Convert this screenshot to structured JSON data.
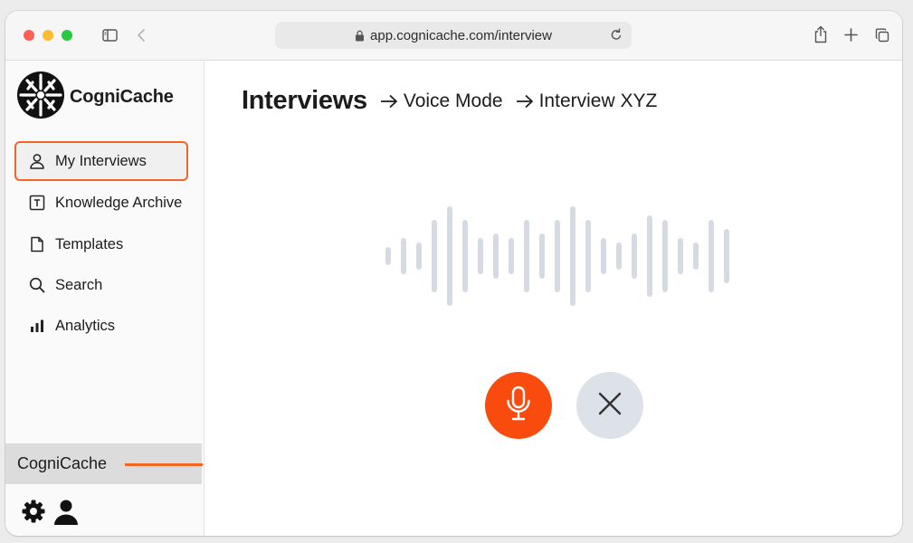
{
  "browser": {
    "url": "app.cognicache.com/interview",
    "icons": [
      "sidebar-toggle-icon",
      "back-icon",
      "lock-icon",
      "reload-icon",
      "share-icon",
      "new-tab-icon",
      "tabs-overview-icon"
    ]
  },
  "sidebar": {
    "logo_text": "CogniCache",
    "items": [
      {
        "label": "My Interviews",
        "icon": "person-icon",
        "active": true
      },
      {
        "label": "Knowledge Archive",
        "icon": "archive-icon",
        "active": false
      },
      {
        "label": "Templates",
        "icon": "document-icon",
        "active": false
      },
      {
        "label": "Search",
        "icon": "search-icon",
        "active": false
      },
      {
        "label": "Analytics",
        "icon": "analytics-icon",
        "active": false
      }
    ],
    "coach_label": "CogniCache",
    "footer_icons": [
      "settings-icon",
      "user-icon"
    ]
  },
  "main": {
    "title": "Interviews",
    "breadcrumb": [
      "Voice Mode",
      "Interview XYZ"
    ],
    "waveform_levels": [
      0.18,
      0.36,
      0.27,
      0.72,
      1.0,
      0.72,
      0.36,
      0.45,
      0.36,
      0.72,
      0.45,
      0.72,
      1.0,
      0.72,
      0.36,
      0.27,
      0.45,
      0.82,
      0.72,
      0.36,
      0.27,
      0.72,
      0.54
    ]
  },
  "colors": {
    "accent": "#f26522",
    "mic_button": "#fa4b0f",
    "close_button": "#dde1e8",
    "waveform": "#d6dbe3"
  }
}
